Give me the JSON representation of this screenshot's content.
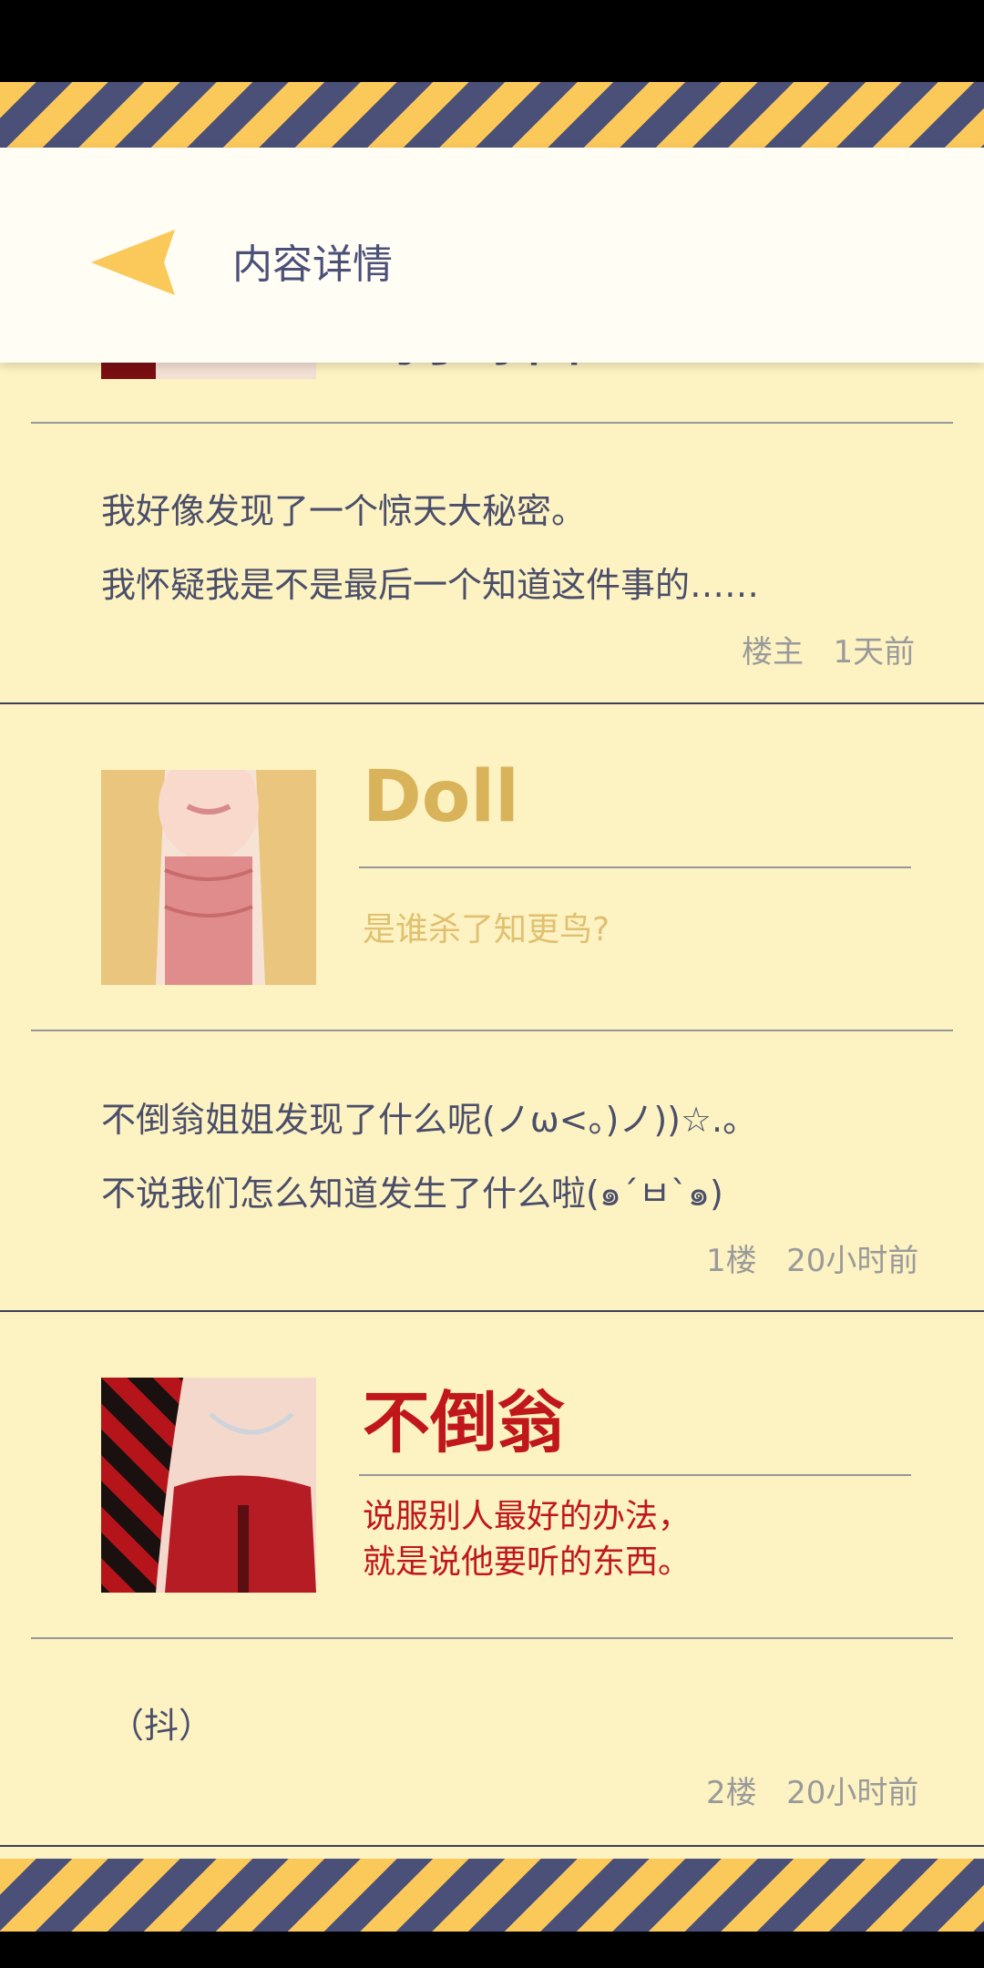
{
  "header": {
    "title": "内容详情",
    "back_icon": "back-triangle-icon"
  },
  "colors": {
    "stripe_yellow": "#fbc85a",
    "stripe_navy": "#4a5077",
    "background": "#fdf2c2",
    "doll_name": "#d9b35a",
    "budaoweng_name": "#c0171b"
  },
  "op_post": {
    "partial_name": "蚂子冰曲",
    "lines": [
      "我好像发现了一个惊天大秘密。",
      "我怀疑我是不是最后一个知道这件事的……"
    ],
    "floor": "楼主",
    "time": "1天前"
  },
  "replies": [
    {
      "name": "Doll",
      "motto": "是谁杀了知更鸟?",
      "lines": [
        "不倒翁姐姐发现了什么呢(ノω<。)ノ))☆.。",
        "不说我们怎么知道发生了什么啦(๑´ㅂ`๑)"
      ],
      "floor": "1楼",
      "time": "20小时前"
    },
    {
      "name": "不倒翁",
      "motto_lines": [
        "说服别人最好的办法，",
        "就是说他要听的东西。"
      ],
      "lines": [
        "（抖）"
      ],
      "floor": "2楼",
      "time": "20小时前"
    }
  ]
}
